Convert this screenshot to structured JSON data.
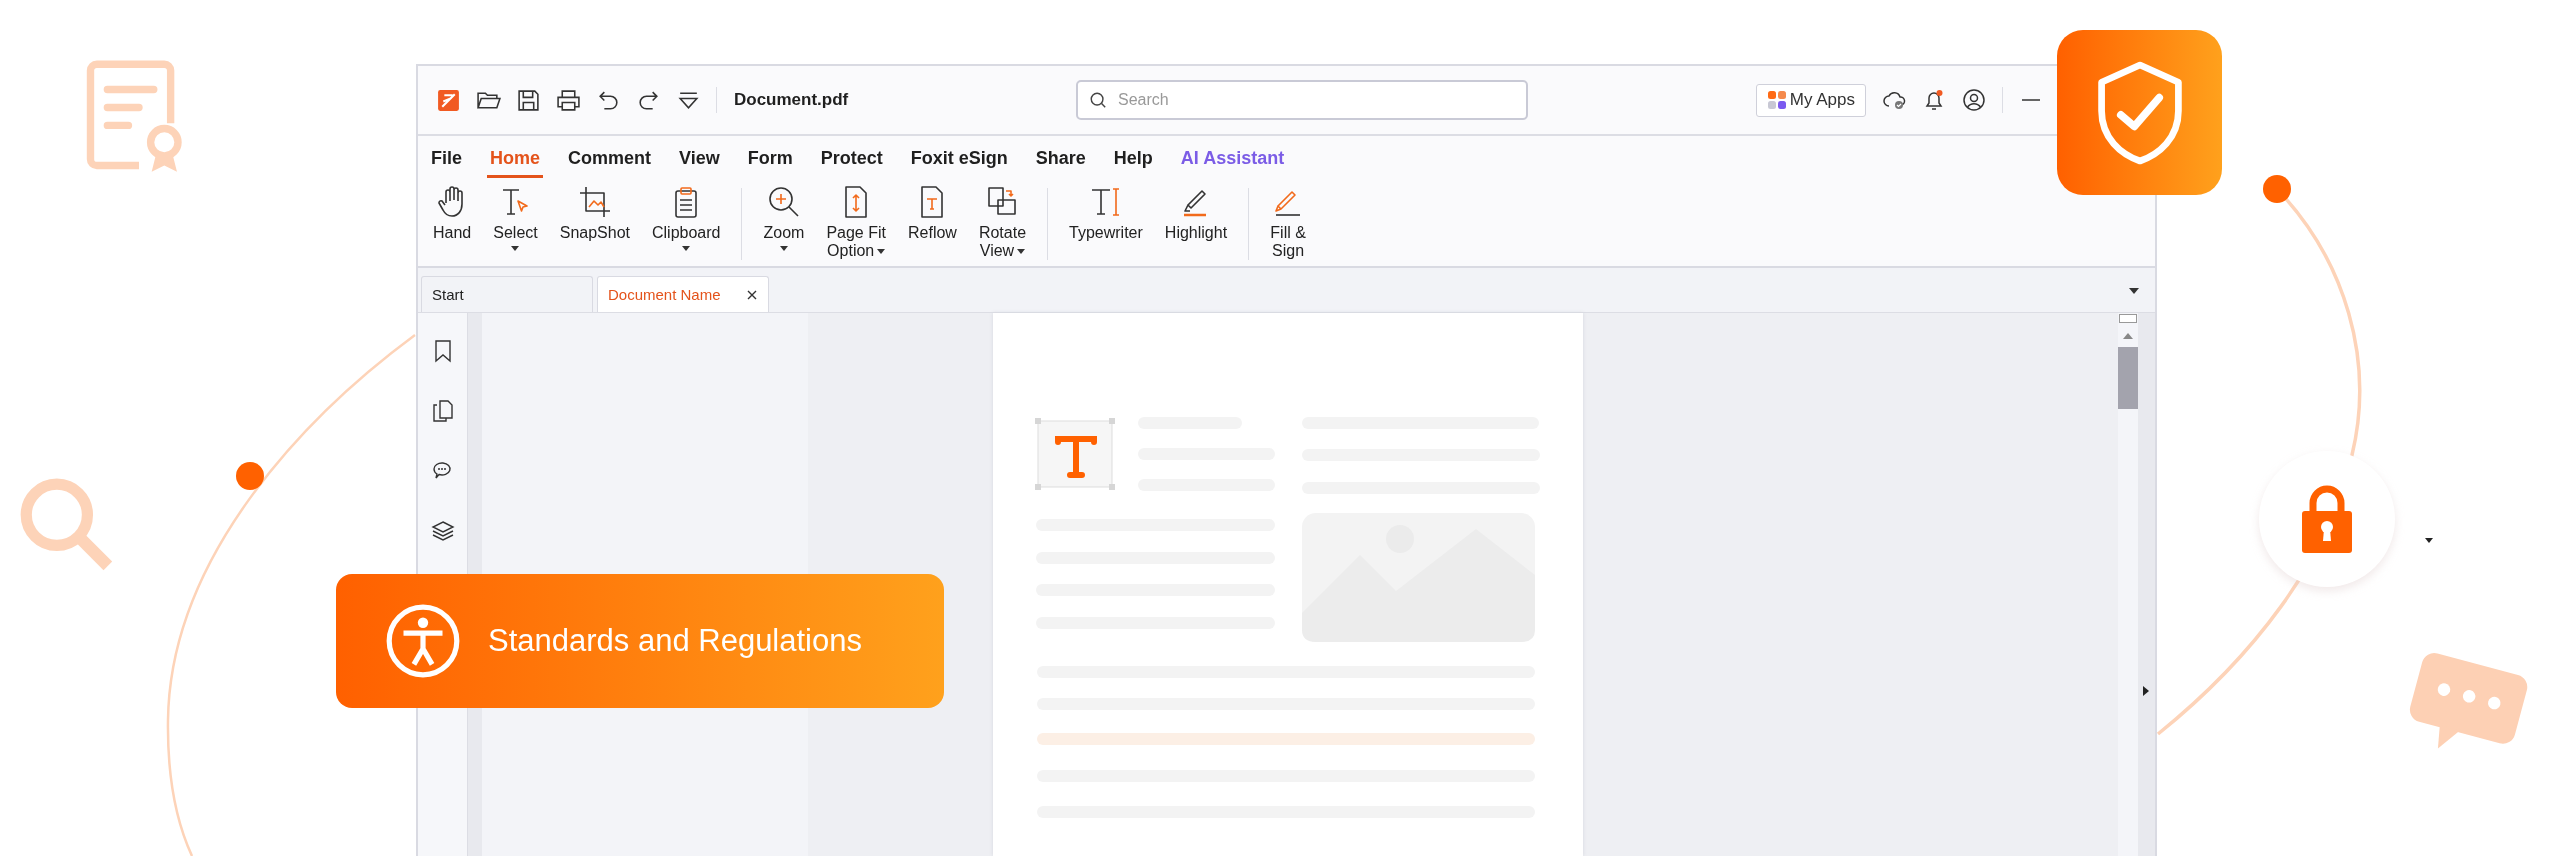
{
  "window": {
    "title": "Document.pdf"
  },
  "search": {
    "placeholder": "Search"
  },
  "my_apps": {
    "label": "My Apps"
  },
  "notifications": {
    "unread": true
  },
  "menu": [
    {
      "label": "File",
      "selected": false,
      "kind": "standard"
    },
    {
      "label": "Home",
      "selected": true,
      "kind": "standard"
    },
    {
      "label": "Comment",
      "selected": false,
      "kind": "standard"
    },
    {
      "label": "View",
      "selected": false,
      "kind": "standard"
    },
    {
      "label": "Form",
      "selected": false,
      "kind": "standard"
    },
    {
      "label": "Protect",
      "selected": false,
      "kind": "standard"
    },
    {
      "label": "Foxit eSign",
      "selected": false,
      "kind": "standard"
    },
    {
      "label": "Share",
      "selected": false,
      "kind": "standard"
    },
    {
      "label": "Help",
      "selected": false,
      "kind": "standard"
    },
    {
      "label": "AI Assistant",
      "selected": false,
      "kind": "assistant"
    }
  ],
  "ribbon": [
    {
      "tools": [
        {
          "label": [
            "Hand"
          ],
          "dropdown": false
        },
        {
          "label": [
            "Select"
          ],
          "dropdown": true
        },
        {
          "label": [
            "SnapShot"
          ],
          "dropdown": false
        },
        {
          "label": [
            "Clipboard"
          ],
          "dropdown": true
        }
      ]
    },
    {
      "tools": [
        {
          "label": [
            "Zoom"
          ],
          "dropdown": true
        },
        {
          "label": [
            "Page Fit",
            "Option"
          ],
          "dropdown": true
        },
        {
          "label": [
            "Reflow"
          ],
          "dropdown": false
        },
        {
          "label": [
            "Rotate",
            "View"
          ],
          "dropdown": true
        }
      ]
    },
    {
      "tools": [
        {
          "label": [
            "Typewriter"
          ],
          "dropdown": false
        },
        {
          "label": [
            "Highlight"
          ],
          "dropdown": false
        }
      ]
    },
    {
      "tools": [
        {
          "label": [
            "Fill &",
            "Sign"
          ],
          "dropdown": false
        }
      ]
    }
  ],
  "doc_tabs": [
    {
      "label": "Start",
      "selected": false,
      "closable": false
    },
    {
      "label": "Document Name",
      "selected": true,
      "closable": true
    }
  ],
  "badge": {
    "label": "Standards and Regulations"
  }
}
